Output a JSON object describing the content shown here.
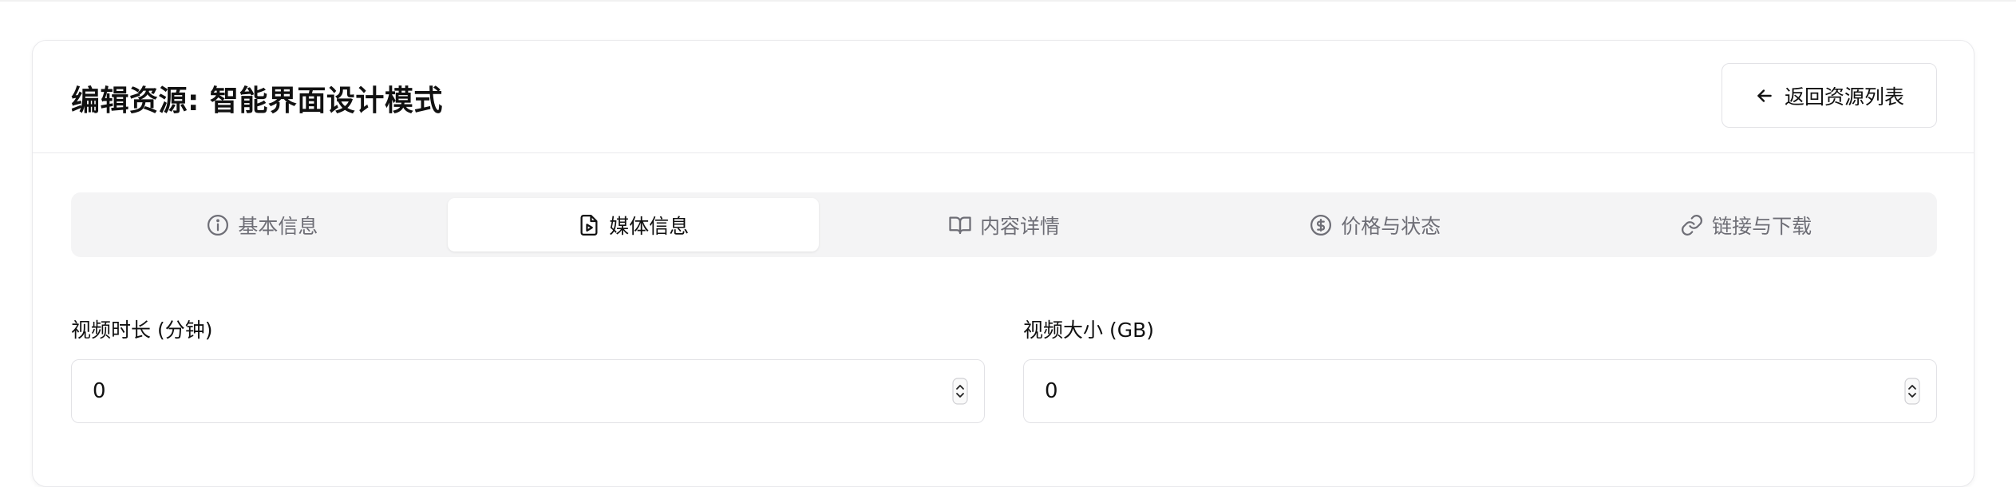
{
  "header": {
    "title": "编辑资源: 智能界面设计模式",
    "back_button_label": "返回资源列表"
  },
  "tabs": [
    {
      "label": "基本信息",
      "icon": "info-circle-icon",
      "active": false
    },
    {
      "label": "媒体信息",
      "icon": "video-file-icon",
      "active": true
    },
    {
      "label": "内容详情",
      "icon": "book-open-icon",
      "active": false
    },
    {
      "label": "价格与状态",
      "icon": "dollar-circle-icon",
      "active": false
    },
    {
      "label": "链接与下载",
      "icon": "link-icon",
      "active": false
    }
  ],
  "form": {
    "duration": {
      "label": "视频时长 (分钟)",
      "value": "0"
    },
    "size": {
      "label": "视频大小 (GB)",
      "value": "0"
    }
  },
  "colors": {
    "tab_bar_background": "#f4f4f5",
    "inactive_tab_text": "#6e6e76",
    "border": "#e2e2e6"
  }
}
